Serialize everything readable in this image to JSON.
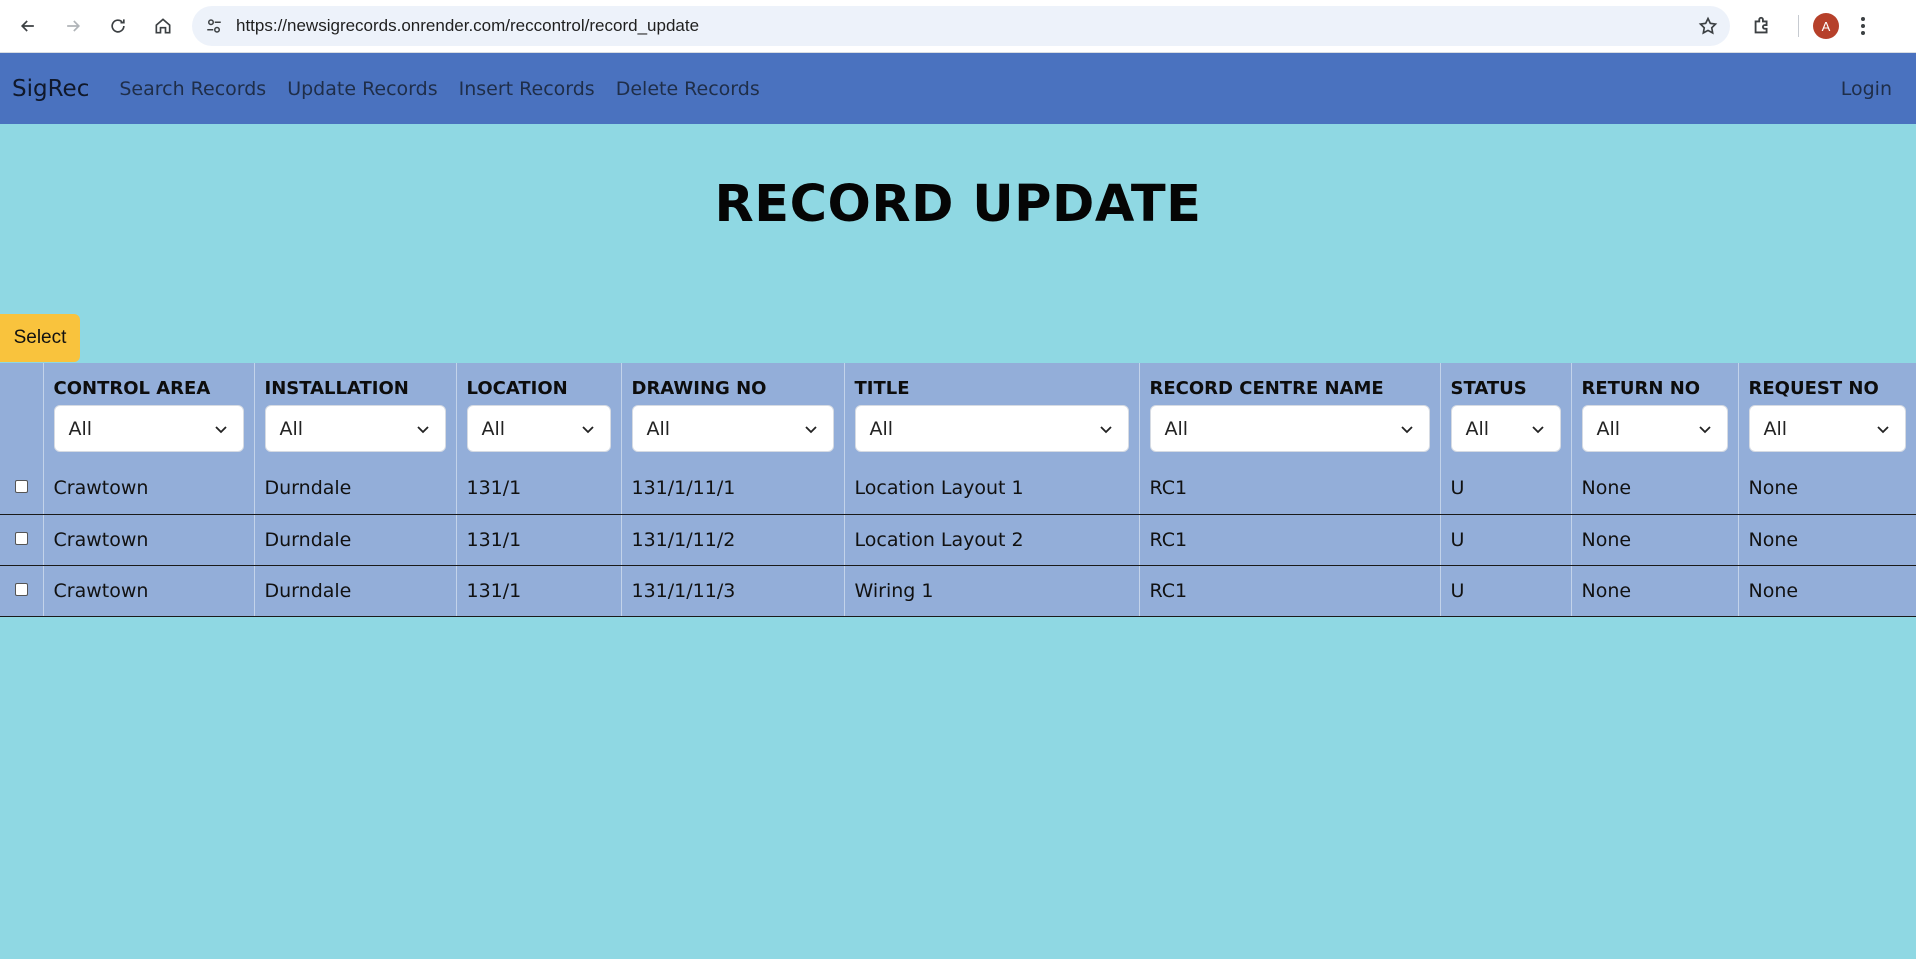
{
  "browser": {
    "url": "https://newsigrecords.onrender.com/reccontrol/record_update",
    "avatar_letter": "A"
  },
  "navbar": {
    "brand": "SigRec",
    "links": [
      "Search Records",
      "Update Records",
      "Insert Records",
      "Delete Records"
    ],
    "login": "Login"
  },
  "page": {
    "title": "RECORD UPDATE",
    "select_button": "Select"
  },
  "table": {
    "columns": [
      {
        "label": "CONTROL AREA",
        "filter": "All"
      },
      {
        "label": "INSTALLATION",
        "filter": "All"
      },
      {
        "label": "LOCATION",
        "filter": "All"
      },
      {
        "label": "DRAWING NO",
        "filter": "All"
      },
      {
        "label": "TITLE",
        "filter": "All"
      },
      {
        "label": "RECORD CENTRE NAME",
        "filter": "All"
      },
      {
        "label": "STATUS",
        "filter": "All"
      },
      {
        "label": "RETURN NO",
        "filter": "All"
      },
      {
        "label": "REQUEST NO",
        "filter": "All"
      }
    ],
    "rows": [
      [
        "Crawtown",
        "Durndale",
        "131/1",
        "131/1/11/1",
        "Location Layout 1",
        "RC1",
        "U",
        "None",
        "None"
      ],
      [
        "Crawtown",
        "Durndale",
        "131/1",
        "131/1/11/2",
        "Location Layout 2",
        "RC1",
        "U",
        "None",
        "None"
      ],
      [
        "Crawtown",
        "Durndale",
        "131/1",
        "131/1/11/3",
        "Wiring 1",
        "RC1",
        "U",
        "None",
        "None"
      ]
    ]
  },
  "colors": {
    "page_bg": "#8fd8e3",
    "navbar_bg": "#4a72bf",
    "table_bg": "#93aed9",
    "select_button_bg": "#f9c33d"
  }
}
